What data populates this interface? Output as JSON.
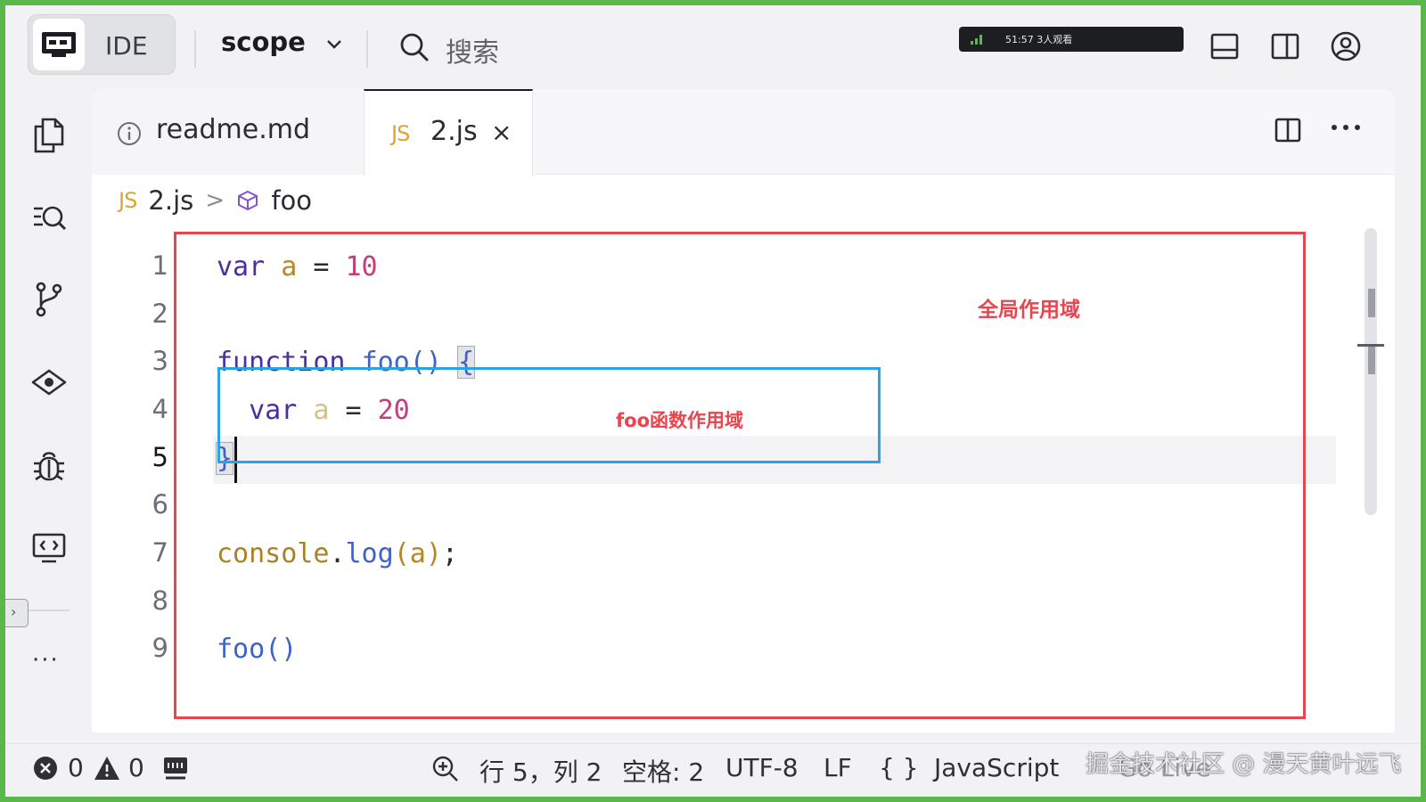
{
  "topbar": {
    "ide_label": "IDE",
    "project": "scope",
    "search_label": "搜索",
    "live": {
      "time": "51:57",
      "viewers": "3人观看"
    }
  },
  "tabs": [
    {
      "label": "readme.md",
      "icon": "info-icon",
      "active": false
    },
    {
      "label": "2.js",
      "badge": "JS",
      "active": true,
      "close": "×"
    }
  ],
  "breadcrumb": {
    "badge": "JS",
    "file": "2.js",
    "separator": ">",
    "symbol": "foo"
  },
  "editor": {
    "line_numbers": [
      "1",
      "2",
      "3",
      "4",
      "5",
      "6",
      "7",
      "8",
      "9"
    ],
    "current_line": 5,
    "code": {
      "l1": {
        "kw": "var",
        "id": "a",
        "op": "=",
        "num": "10"
      },
      "l3": {
        "kw": "function",
        "fn": "foo",
        "parens": "()",
        "brace": "{"
      },
      "l4": {
        "kw": "var",
        "id": "a",
        "op": "=",
        "num": "20"
      },
      "l5": {
        "brace": "}"
      },
      "l7": {
        "obj": "console",
        "dot": ".",
        "fn": "log",
        "open": "(",
        "arg": "a",
        "close": ")",
        "semi": ";"
      },
      "l9": {
        "fn": "foo",
        "parens": "()"
      }
    }
  },
  "annotations": {
    "global_scope": "全局作用域",
    "foo_scope": "foo函数作用域",
    "colors": {
      "global_box": "#e8454f",
      "foo_box": "#2aa3e6"
    }
  },
  "statusbar": {
    "errors": "0",
    "warnings": "0",
    "position": "行 5，列 2",
    "indent": "空格: 2",
    "encoding": "UTF-8",
    "eol": "LF",
    "braces": "{ }",
    "language": "JavaScript",
    "go_live": "Go Live",
    "watermark": "掘金技术社区 @ 漫天黄叶远飞"
  },
  "colors": {
    "keyword": "#4a2fa3",
    "identifier": "#b1892a",
    "number": "#c43f78",
    "function": "#3e62c8",
    "js_badge": "#d9a533",
    "frame_border": "#5ab84a"
  }
}
